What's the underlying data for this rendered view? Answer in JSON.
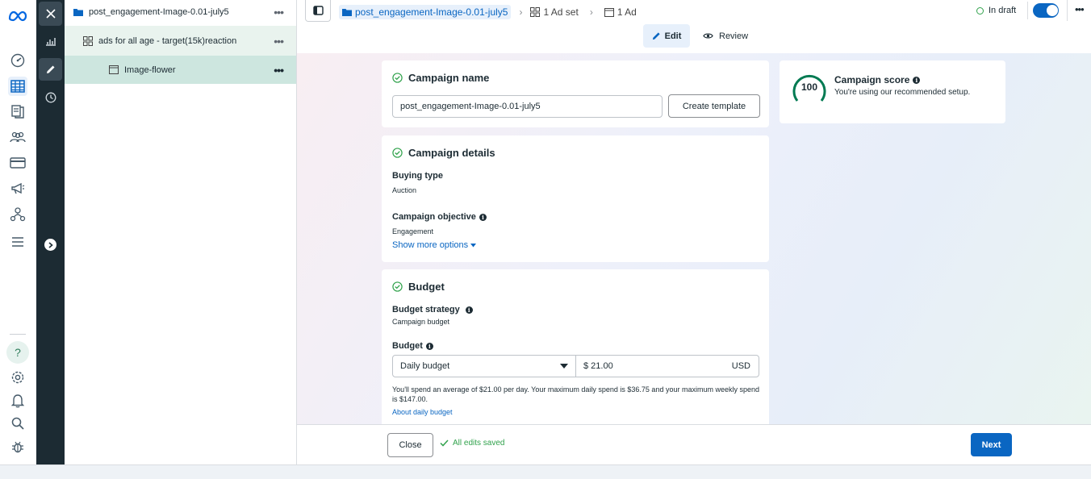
{
  "rail": {
    "items": [
      "meta-logo",
      "dashboard-icon",
      "campaigns-table-icon",
      "pages-icon",
      "audiences-icon",
      "billing-icon",
      "ads-icon",
      "hierarchy-icon",
      "menu-icon"
    ],
    "bottom": [
      "help-icon",
      "settings-icon",
      "notifications-icon",
      "search-icon",
      "bug-icon"
    ]
  },
  "tree": {
    "campaign": "post_engagement-Image-0.01-july5",
    "adset": "ads for all age - target(15k)reaction",
    "ad": "Image-flower",
    "dots": "•••"
  },
  "topbar": {
    "campaign_crumb": "post_engagement-Image-0.01-july5",
    "adset_crumb": "1 Ad set",
    "ad_crumb": "1 Ad",
    "status": "In draft",
    "edit_label": "Edit",
    "review_label": "Review",
    "more": "•••"
  },
  "campaign_name": {
    "title": "Campaign name",
    "value": "post_engagement-Image-0.01-july5",
    "template_button": "Create template"
  },
  "campaign_details": {
    "title": "Campaign details",
    "buying_type_label": "Buying type",
    "buying_type_value": "Auction",
    "objective_label": "Campaign objective",
    "objective_value": "Engagement",
    "more_options": "Show more options"
  },
  "budget": {
    "title": "Budget",
    "strategy_label": "Budget strategy",
    "strategy_value": "Campaign budget",
    "budget_label": "Budget",
    "budget_type": "Daily budget",
    "amount": "$ 21.00",
    "currency": "USD",
    "note": "You'll spend an average of $21.00 per day. Your maximum daily spend is $36.75 and your maximum weekly spend is $147.00.",
    "about_link": "About daily budget"
  },
  "score": {
    "value": "100",
    "title": "Campaign score",
    "subtitle": "You're using our recommended setup."
  },
  "footer": {
    "close": "Close",
    "saved": "All edits saved",
    "next": "Next"
  },
  "colors": {
    "accent": "#0a66c2",
    "success": "#31a24c",
    "score_ring": "#007a52",
    "dark": "#1c2b33"
  }
}
